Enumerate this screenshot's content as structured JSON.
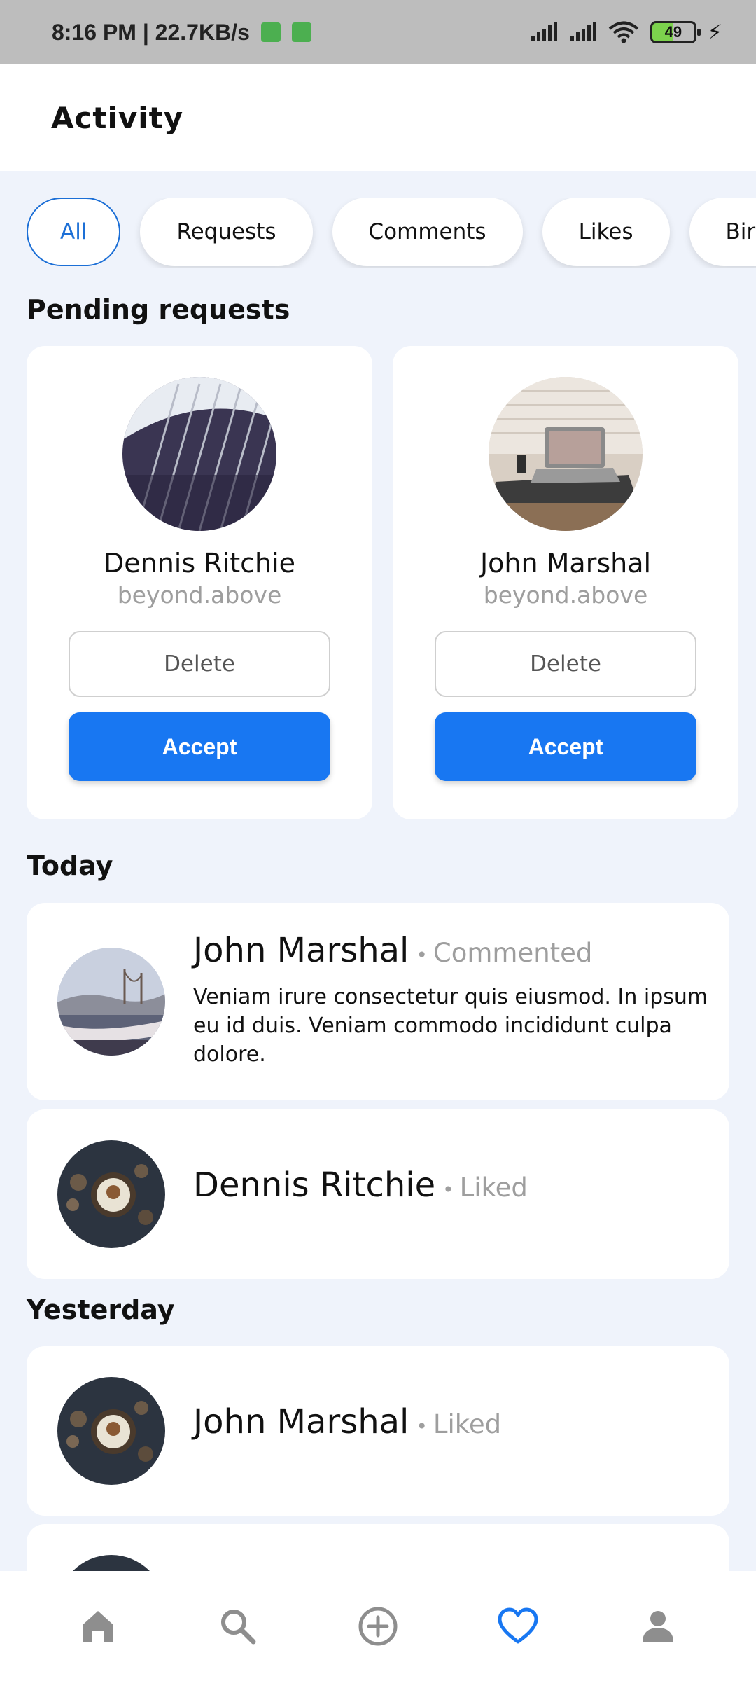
{
  "status_bar": {
    "time_speed": "8:16 PM | 22.7KB/s",
    "battery": "49",
    "icons": [
      "signal-icon",
      "signal-icon",
      "wifi-icon",
      "battery-icon",
      "charging-icon"
    ]
  },
  "header": {
    "title": "Activity"
  },
  "filters": {
    "items": [
      "All",
      "Requests",
      "Comments",
      "Likes",
      "Bir"
    ],
    "active": "All"
  },
  "pending": {
    "title": "Pending requests",
    "cards": [
      {
        "name": "Dennis Ritchie",
        "handle": "beyond.above",
        "delete_label": "Delete",
        "accept_label": "Accept"
      },
      {
        "name": "John Marshal",
        "handle": "beyond.above",
        "delete_label": "Delete",
        "accept_label": "Accept"
      }
    ]
  },
  "today": {
    "title": "Today",
    "items": [
      {
        "name": "John Marshal",
        "action": "Commented",
        "text": "Veniam irure consectetur quis eiusmod. In ipsum eu id duis. Veniam commodo incididunt culpa dolore."
      },
      {
        "name": "Dennis Ritchie",
        "action": "Liked"
      }
    ]
  },
  "yesterday": {
    "title": "Yesterday",
    "items": [
      {
        "name": "John Marshal",
        "action": "Liked"
      }
    ]
  },
  "bottom_nav": {
    "items": [
      "home-icon",
      "search-icon",
      "add-circle-icon",
      "heart-icon",
      "profile-icon"
    ],
    "active": "heart-icon"
  },
  "colors": {
    "accent": "#1877f2",
    "chip_active": "#1c6fd6",
    "background": "#eff3fb",
    "muted": "#9e9e9e"
  }
}
